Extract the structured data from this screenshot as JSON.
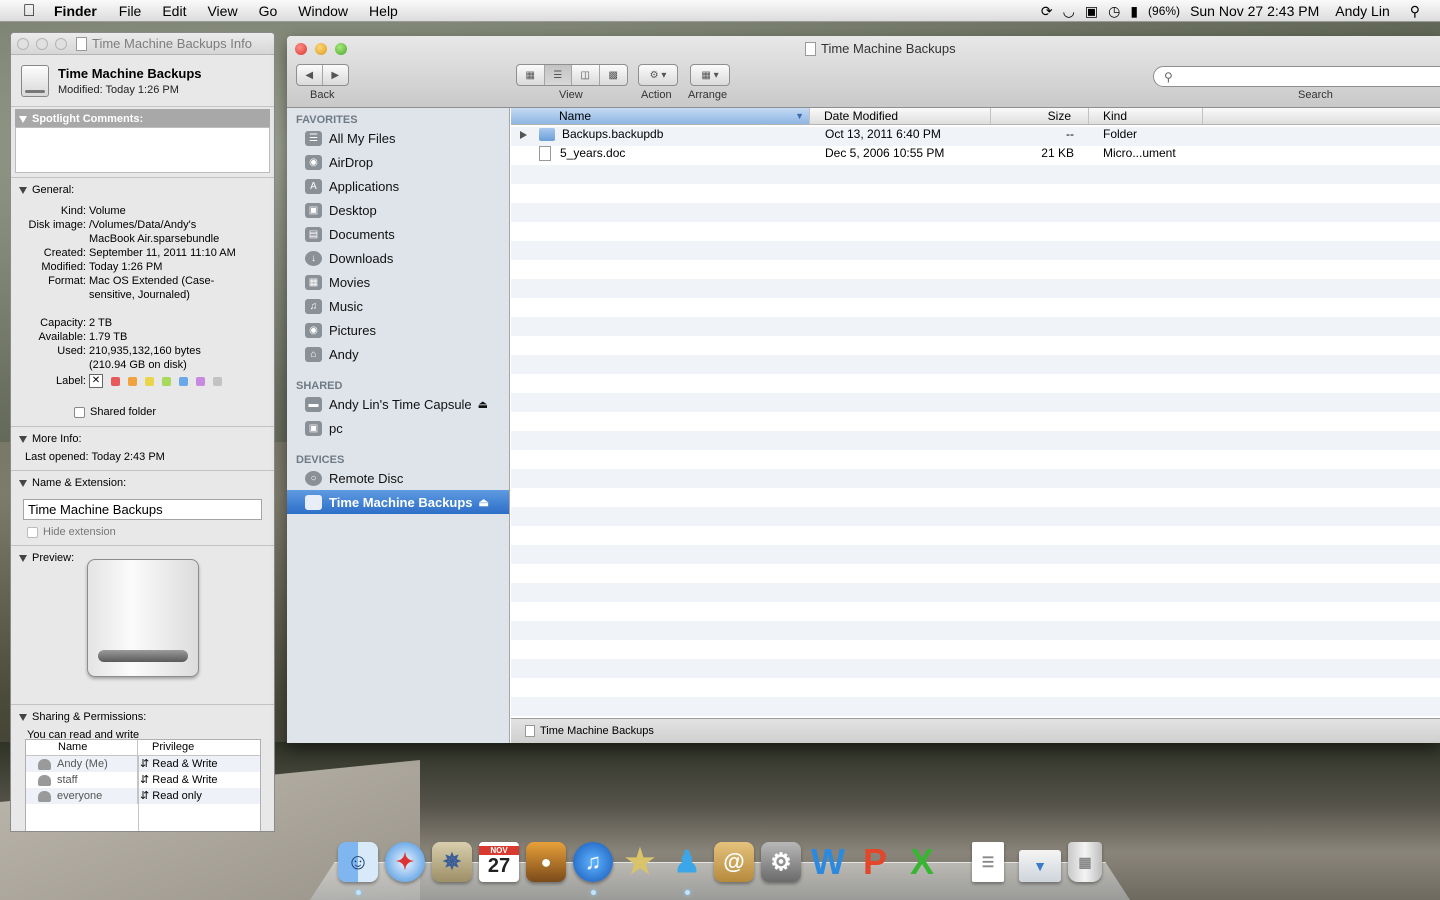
{
  "menubar": {
    "app": "Finder",
    "items": [
      "File",
      "Edit",
      "View",
      "Go",
      "Window",
      "Help"
    ],
    "battery": "(96%)",
    "clock": "Sun Nov 27  2:43 PM",
    "user": "Andy Lin"
  },
  "info": {
    "title": "Time Machine Backups Info",
    "name": "Time Machine Backups",
    "modified": "Modified: Today 1:26 PM",
    "spotlight": "Spotlight Comments:",
    "general": "General:",
    "rows": [
      {
        "k": "Kind:",
        "v": "Volume"
      },
      {
        "k": "Disk image:",
        "v": "/Volumes/Data/Andy's MacBook Air.sparsebundle"
      },
      {
        "k": "Created:",
        "v": "September 11, 2011 11:10 AM"
      },
      {
        "k": "Modified:",
        "v": "Today 1:26 PM"
      },
      {
        "k": "Format:",
        "v": "Mac OS Extended (Case-sensitive, Journaled)"
      }
    ],
    "rows2": [
      {
        "k": "Capacity:",
        "v": "2 TB"
      },
      {
        "k": "Available:",
        "v": "1.79 TB"
      },
      {
        "k": "Used:",
        "v": "210,935,132,160 bytes (210.94 GB on disk)"
      }
    ],
    "label": "Label:",
    "label_colors": [
      "#e85a5a",
      "#f0a23c",
      "#e9d54a",
      "#a9d95a",
      "#6aa8e8",
      "#c88ae0",
      "#c2c2c2"
    ],
    "shared_folder": "Shared folder",
    "more_info": "More Info:",
    "last_opened": "Last opened: Today 2:43 PM",
    "name_ext": "Name & Extension:",
    "name_value": "Time Machine Backups",
    "hide_ext": "Hide extension",
    "preview": "Preview:",
    "sharing": "Sharing & Permissions:",
    "you_can": "You can read and write",
    "perm_headers": [
      "Name",
      "Privilege"
    ],
    "perms": [
      {
        "name": "Andy (Me)",
        "priv": "Read & Write"
      },
      {
        "name": "staff",
        "priv": "Read & Write"
      },
      {
        "name": "everyone",
        "priv": "Read only"
      }
    ]
  },
  "finder": {
    "title": "Time Machine Backups",
    "toolbar": {
      "back": "Back",
      "view": "View",
      "action": "Action",
      "arrange": "Arrange",
      "search": "Search"
    },
    "sidebar": {
      "favorites": "FAVORITES",
      "fav_items": [
        "All My Files",
        "AirDrop",
        "Applications",
        "Desktop",
        "Documents",
        "Downloads",
        "Movies",
        "Music",
        "Pictures",
        "Andy"
      ],
      "shared": "SHARED",
      "shared_items": [
        "Andy Lin's Time Capsule",
        "pc"
      ],
      "devices": "DEVICES",
      "device_items": [
        "Remote Disc",
        "Time Machine Backups"
      ]
    },
    "columns": [
      "Name",
      "Date Modified",
      "Size",
      "Kind"
    ],
    "files": [
      {
        "name": "Backups.backupdb",
        "date": "Oct 13, 2011 6:40 PM",
        "size": "--",
        "kind": "Folder"
      },
      {
        "name": "5_years.doc",
        "date": "Dec 5, 2006 10:55 PM",
        "size": "21 KB",
        "kind": "Micro...ument"
      }
    ],
    "status": "Time Machine Backups"
  },
  "dock": {
    "icons": [
      "finder-icon",
      "safari-icon",
      "mail-icon",
      "ical-icon",
      "iphoto-icon",
      "itunes-icon",
      "imovie-icon",
      "messenger-icon",
      "address-book-icon",
      "system-preferences-icon",
      "word-icon",
      "powerpoint-icon",
      "excel-icon",
      "documents-stack-icon",
      "downloads-stack-icon",
      "trash-icon"
    ],
    "ical_month": "NOV",
    "ical_day": "27"
  }
}
